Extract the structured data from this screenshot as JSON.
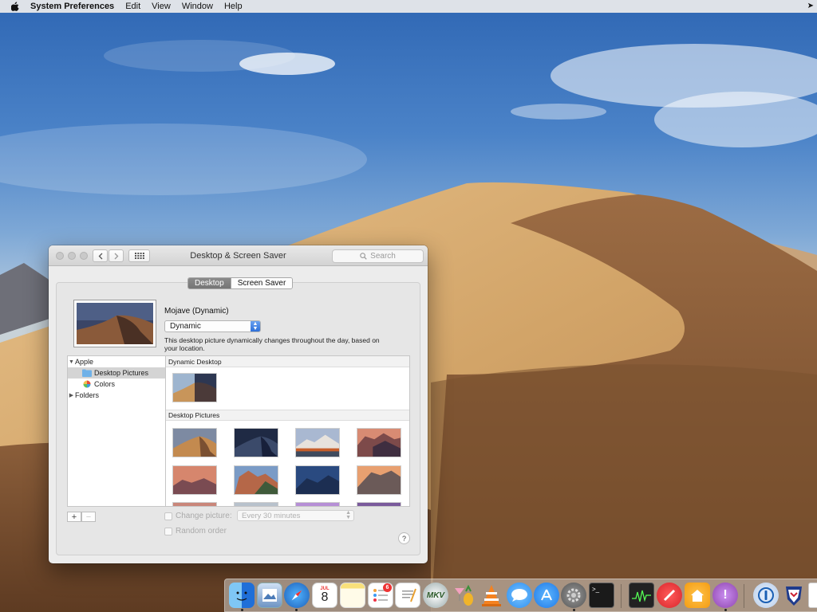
{
  "menubar": {
    "app_name": "System Preferences",
    "items": [
      "Edit",
      "View",
      "Window",
      "Help"
    ]
  },
  "window": {
    "title": "Desktop & Screen Saver",
    "search_placeholder": "Search",
    "tabs": [
      {
        "label": "Desktop",
        "active": true
      },
      {
        "label": "Screen Saver",
        "active": false
      }
    ],
    "picture_name": "Mojave (Dynamic)",
    "mode_popup": "Dynamic",
    "description": "This desktop picture dynamically changes throughout the day, based on your location.",
    "sidebar": [
      {
        "label": "Apple",
        "expanded": true
      },
      {
        "label": "Desktop Pictures",
        "selected": true
      },
      {
        "label": "Colors"
      },
      {
        "label": "Folders",
        "expanded": false
      }
    ],
    "sections": [
      "Dynamic Desktop",
      "Desktop Pictures"
    ],
    "change_picture_label": "Change picture:",
    "change_interval": "Every 30 minutes",
    "random_order_label": "Random order",
    "add_label": "+",
    "remove_label": "−",
    "help_label": "?"
  },
  "dock": {
    "items": [
      "finder-icon",
      "preview-icon",
      "safari-icon",
      "calendar-icon",
      "notes-icon",
      "reminders-icon",
      "textedit-icon",
      "mkv-icon",
      "cocktail-icon",
      "vlc-icon",
      "messages-icon",
      "app-store-icon",
      "system-preferences-icon",
      "terminal-icon",
      "activity-monitor-icon",
      "news-icon",
      "home-icon",
      "feedback-icon",
      "1password-icon",
      "badge-icon"
    ],
    "calendar_day": "8",
    "calendar_month": "JUL",
    "reminders_badge": "6",
    "mkv_label": "MKV",
    "terminal_prompt": ">_"
  }
}
